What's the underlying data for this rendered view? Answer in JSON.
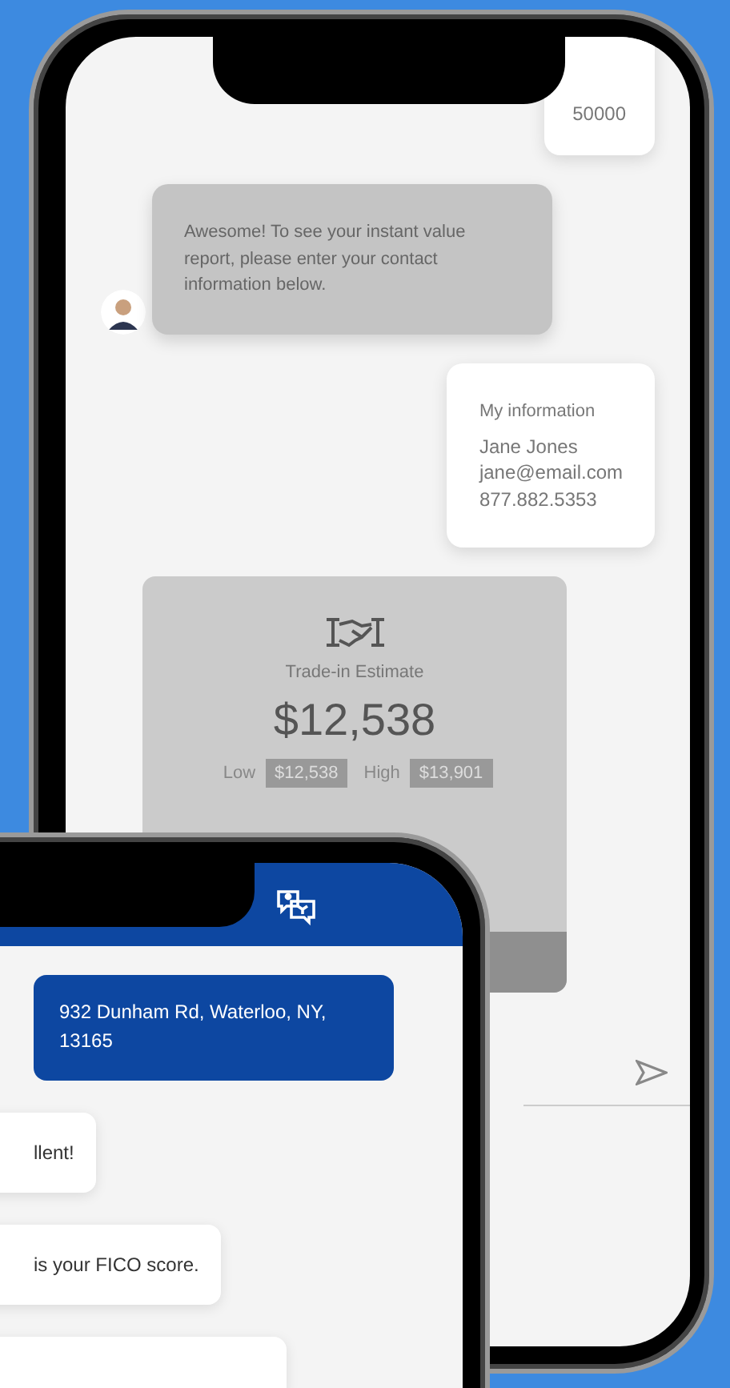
{
  "back_phone": {
    "messages": [
      {
        "kind": "user",
        "lines": [
          "50000"
        ]
      },
      {
        "kind": "bot",
        "lines": [
          "Awesome! To see your instant value report, please enter your contact information below."
        ]
      },
      {
        "kind": "user",
        "title": "My information",
        "lines": [
          "Jane Jones",
          "jane@email.com",
          "877.882.5353"
        ]
      }
    ],
    "estimate": {
      "title": "Trade-in Estimate",
      "value": "$12,538",
      "low_label": "Low",
      "low": "$12,538",
      "high_label": "High",
      "high": "$13,901"
    }
  },
  "front_phone": {
    "messages": [
      {
        "kind": "user",
        "lines": [
          "932 Dunham Rd, Waterloo, NY, 13165"
        ]
      },
      {
        "kind": "bot",
        "lines": [
          "llent!"
        ]
      },
      {
        "kind": "bot",
        "lines": [
          "is your FICO score."
        ]
      },
      {
        "kind": "bot"
      }
    ]
  }
}
